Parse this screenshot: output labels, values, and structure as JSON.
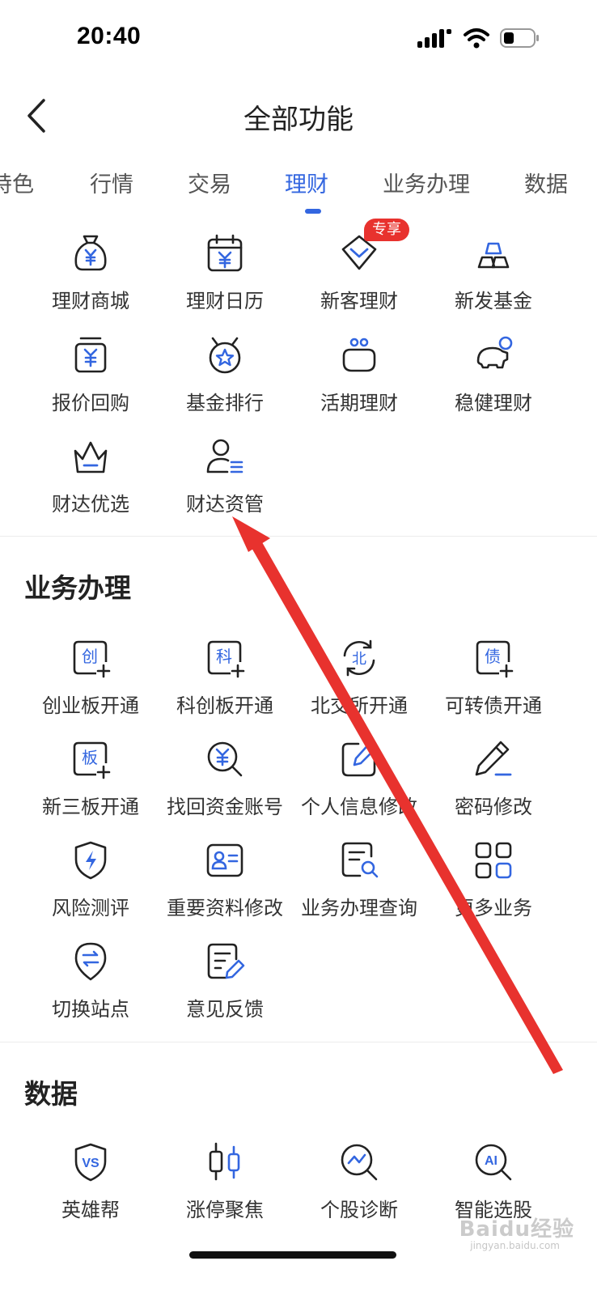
{
  "status_bar": {
    "time": "20:40",
    "icons": [
      "signal-icon",
      "wifi-icon",
      "battery-icon"
    ]
  },
  "header": {
    "title": "全部功能",
    "back_icon": "chevron-left-icon"
  },
  "tabs": [
    {
      "label": "特色",
      "active": false
    },
    {
      "label": "行情",
      "active": false
    },
    {
      "label": "交易",
      "active": false
    },
    {
      "label": "理财",
      "active": true
    },
    {
      "label": "业务办理",
      "active": false
    },
    {
      "label": "数据",
      "active": false
    }
  ],
  "finance": {
    "badge": "专享",
    "items": [
      {
        "label": "理财商城",
        "icon": "money-bag-icon"
      },
      {
        "label": "理财日历",
        "icon": "calendar-yuan-icon"
      },
      {
        "label": "新客理财",
        "icon": "new-customer-icon"
      },
      {
        "label": "新发基金",
        "icon": "gold-bars-icon"
      },
      {
        "label": "报价回购",
        "icon": "yuan-box-icon"
      },
      {
        "label": "基金排行",
        "icon": "medal-star-icon"
      },
      {
        "label": "活期理财",
        "icon": "purse-icon"
      },
      {
        "label": "稳健理财",
        "icon": "piggy-bank-icon"
      },
      {
        "label": "财达优选",
        "icon": "crown-icon"
      },
      {
        "label": "财达资管",
        "icon": "person-list-icon"
      }
    ]
  },
  "business": {
    "title": "业务办理",
    "items": [
      {
        "label": "创业板开通",
        "icon": "chuang-add-icon"
      },
      {
        "label": "科创板开通",
        "icon": "ke-add-icon"
      },
      {
        "label": "北交所开通",
        "icon": "bei-refresh-icon"
      },
      {
        "label": "可转债开通",
        "icon": "zhai-add-icon"
      },
      {
        "label": "新三板开通",
        "icon": "ban-add-icon"
      },
      {
        "label": "找回资金账号",
        "icon": "yuan-search-icon"
      },
      {
        "label": "个人信息修改",
        "icon": "edit-box-icon"
      },
      {
        "label": "密码修改",
        "icon": "pencil-icon"
      },
      {
        "label": "风险测评",
        "icon": "shield-bolt-icon"
      },
      {
        "label": "重要资料修改",
        "icon": "id-card-icon"
      },
      {
        "label": "业务办理查询",
        "icon": "doc-search-icon"
      },
      {
        "label": "更多业务",
        "icon": "grid-icon"
      },
      {
        "label": "切换站点",
        "icon": "switch-site-icon"
      },
      {
        "label": "意见反馈",
        "icon": "feedback-icon"
      }
    ]
  },
  "data_section": {
    "title": "数据",
    "items": [
      {
        "label": "英雄帮",
        "icon": "vs-shield-icon"
      },
      {
        "label": "涨停聚焦",
        "icon": "candlestick-icon"
      },
      {
        "label": "个股诊断",
        "icon": "chart-search-icon"
      },
      {
        "label": "智能选股",
        "icon": "ai-search-icon"
      }
    ]
  },
  "watermark": {
    "brand": "Baidu经验",
    "sub": "jingyan.baidu.com"
  },
  "colors": {
    "accent": "#3366e0",
    "badge": "#e8322e",
    "arrow": "#e8322e"
  }
}
